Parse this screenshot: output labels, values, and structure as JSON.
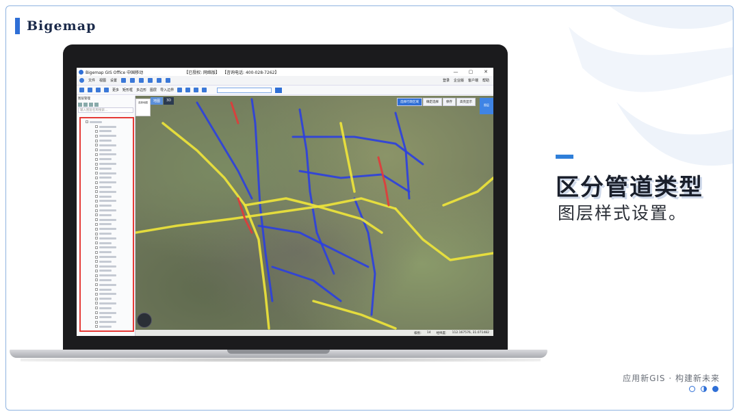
{
  "brand": {
    "name": "Bigemap"
  },
  "headline": {
    "title": "区分管道类型",
    "subtitle": "图层样式设置。"
  },
  "footer": {
    "tagline": "应用新GIS · 构建新未来",
    "pager": [
      "empty",
      "half",
      "full"
    ]
  },
  "app": {
    "window_title": "Bigemap GIS Office 中国移动",
    "license": "【已授权: 网络版】",
    "hotline": "【咨询电话: 400-028-7262】",
    "window_controls": [
      "—",
      "▢",
      "✕"
    ],
    "menu": [
      "文件",
      "视图",
      "设置"
    ],
    "menu_right": [
      "登录",
      "企业版",
      "客户端",
      "帮助"
    ],
    "toolbar": [
      "更多",
      "矩形框",
      "多边形",
      "图层",
      "导入边界"
    ],
    "sidebar_title": "图层管理",
    "sidebar_filter": "输入图层名称搜索...",
    "map_tabs": [
      "地图",
      "3D"
    ],
    "map_tools": [
      "选择行政区域",
      "确定选择",
      "保存",
      "高亮显示"
    ],
    "side_tab": "图层",
    "left_widget": "选择地图",
    "status": {
      "zoom_label": "级别:",
      "zoom": "14",
      "coords_label": "经纬度:",
      "coords": "112.167576, 31.071482"
    }
  },
  "colors": {
    "accent": "#2f7fd9",
    "pipe_blue": "#2b3fe0",
    "pipe_yellow": "#f0e53a",
    "pipe_red": "#e23a3a",
    "highlight": "#e53935"
  }
}
